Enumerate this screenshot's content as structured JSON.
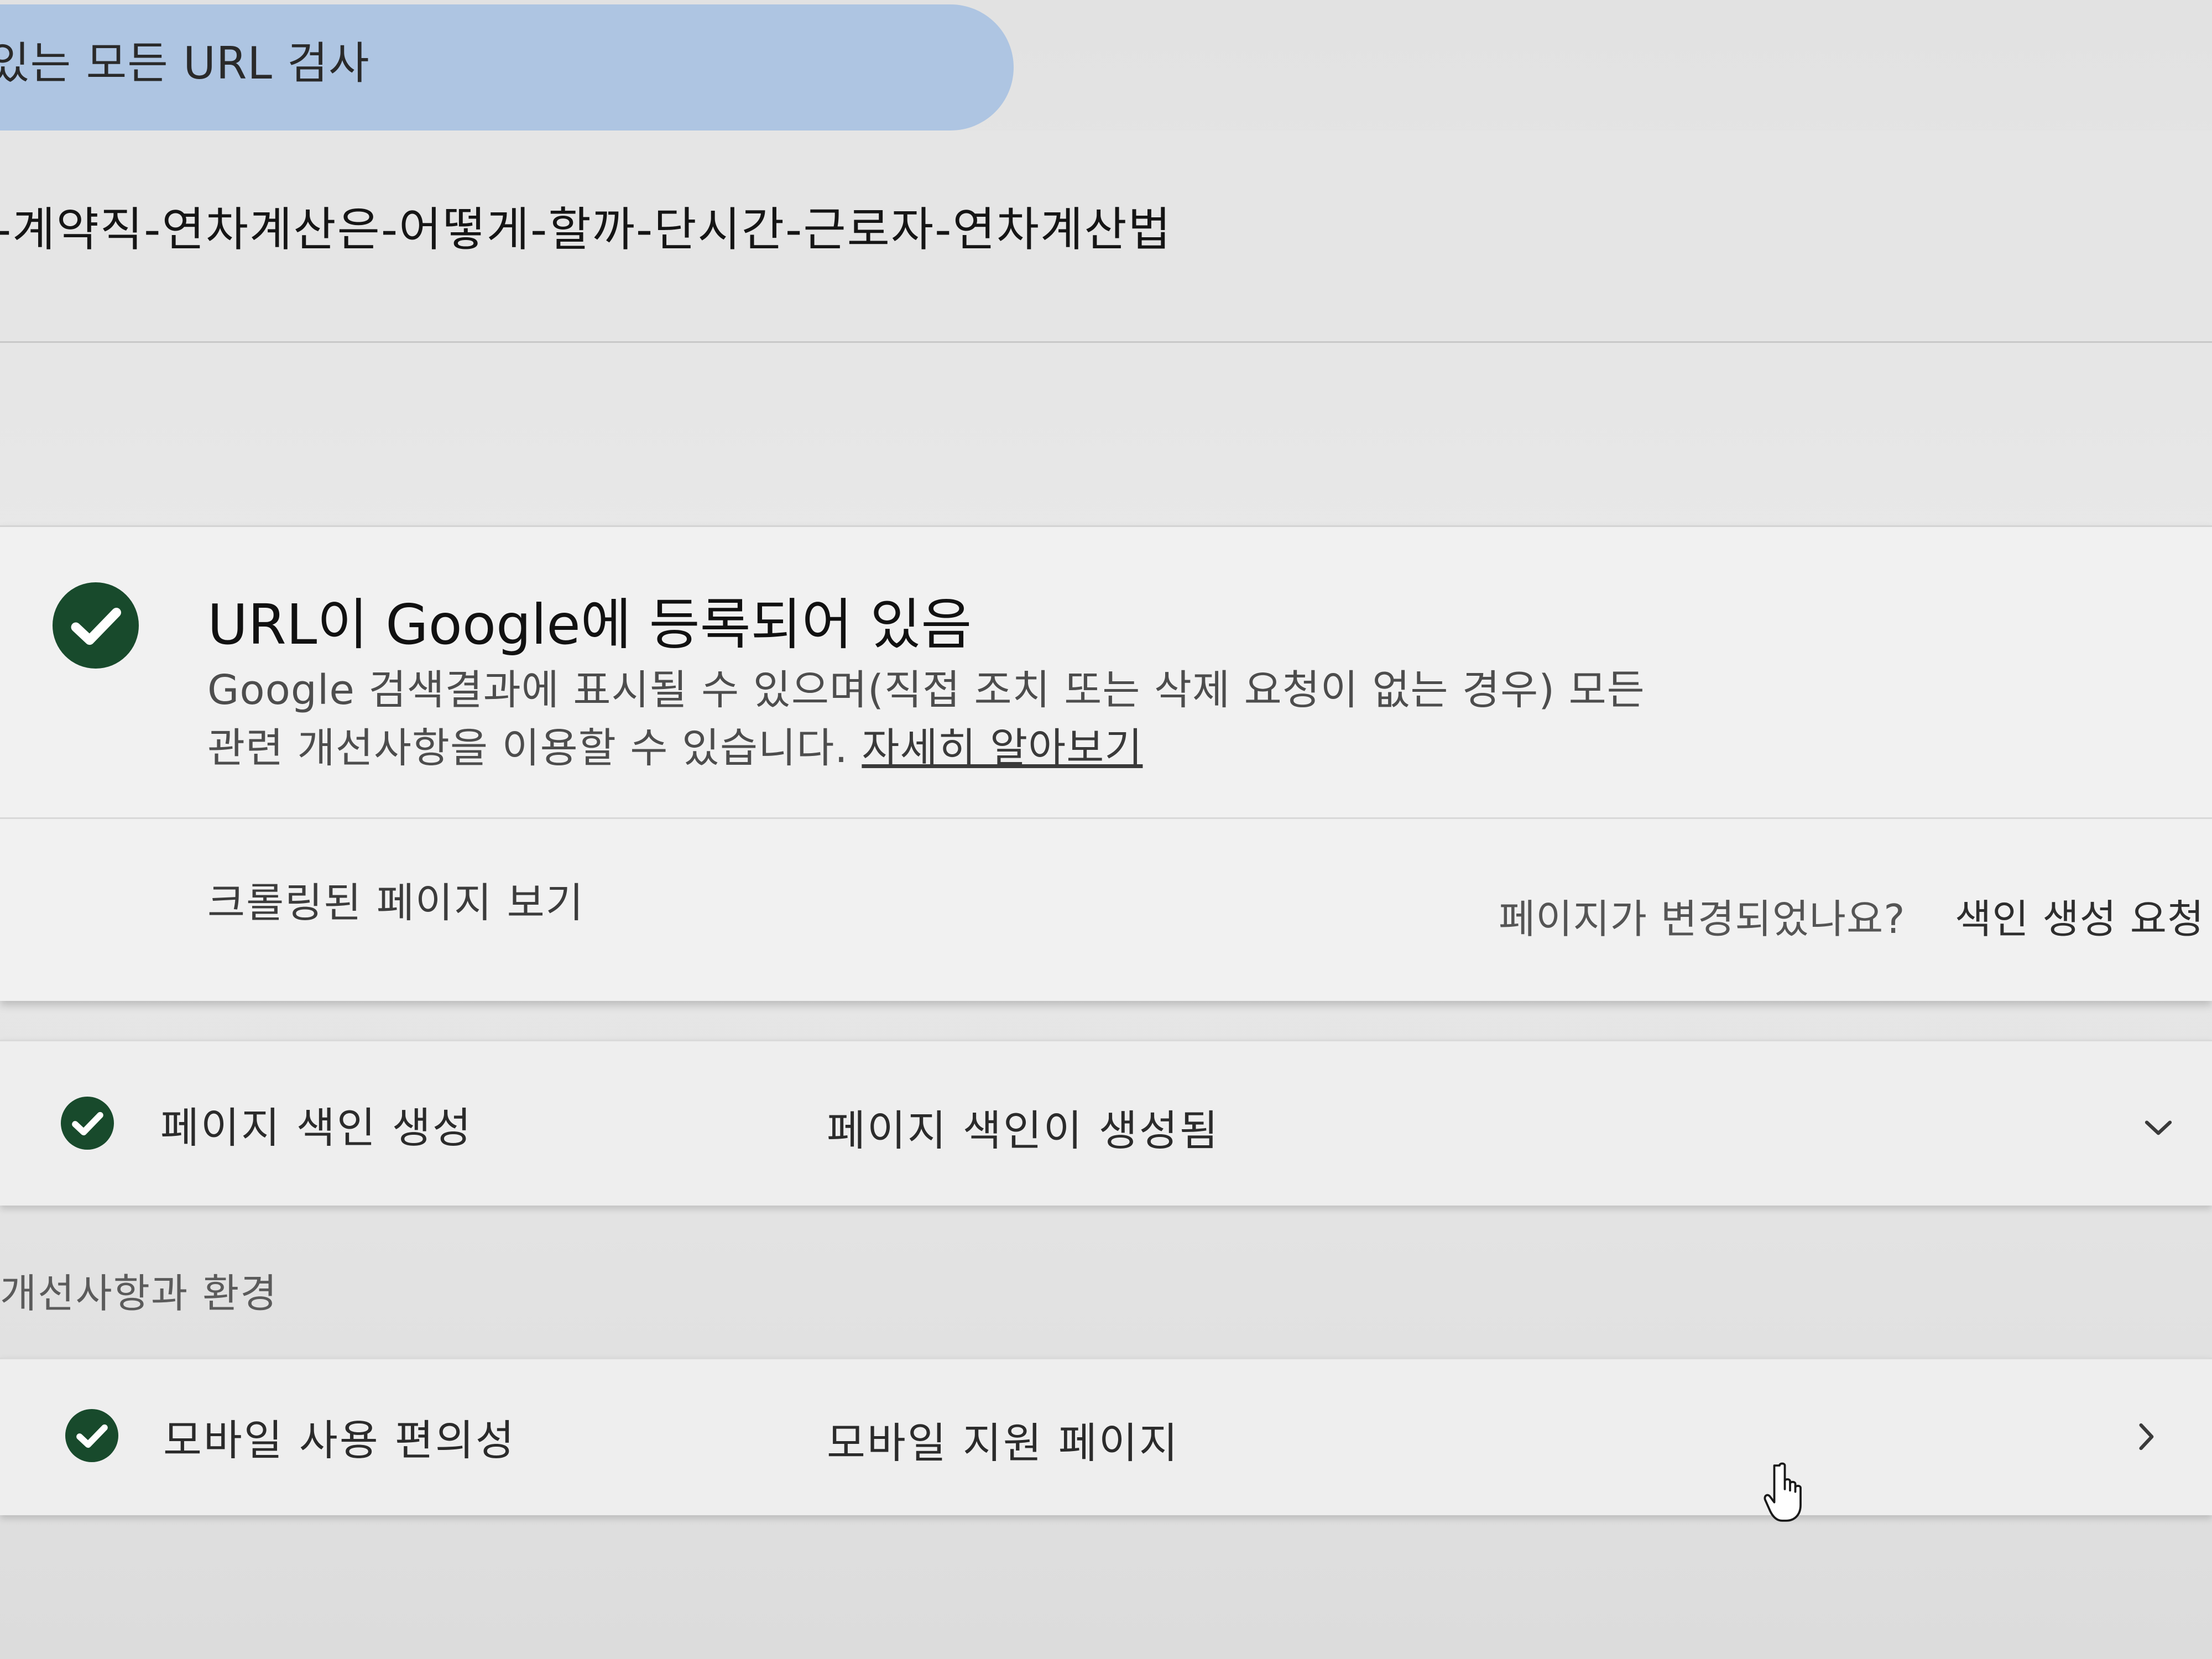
{
  "search": {
    "text": "있는 모든 URL 검사"
  },
  "url_header": {
    "url": "-계약직-연차계산은-어떻게-할까-단시간-근로자-연차계산법"
  },
  "status_card": {
    "icon": "check-circle-icon",
    "title": "URL이 Google에 등록되어 있음",
    "desc_line1": "Google 검색결과에 표시될 수 있으며(직접 조치 또는 삭제 요청이 없는 경우) 모든",
    "desc_line2": "관련 개선사항을 이용할 수 있습니다.",
    "learn_more": "자세히 알아보기",
    "view_crawled": "크롤링된 페이지 보기",
    "page_changed": "페이지가 변경되었나요?",
    "request_indexing": "색인 생성 요청"
  },
  "indexing_row": {
    "icon": "check-circle-icon",
    "label": "페이지 색인 생성",
    "value": "페이지 색인이 생성됨",
    "action_icon": "chevron-down-icon"
  },
  "enhancements": {
    "section_title": "개선사항과 환경"
  },
  "mobile_row": {
    "icon": "check-circle-icon",
    "label": "모바일 사용 편의성",
    "value": "모바일 지원 페이지",
    "action_icon": "chevron-right-icon"
  },
  "cursor": {
    "icon": "hand-pointer-icon"
  },
  "colors": {
    "check_green": "#184a2c",
    "search_bar": "#aec5e2",
    "card_bg": "#f1f1f1"
  }
}
